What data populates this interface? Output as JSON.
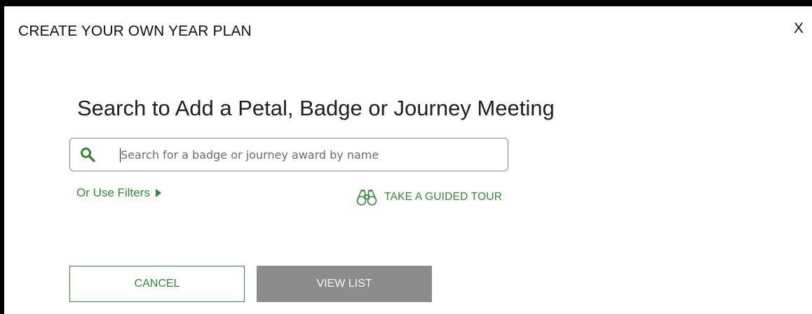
{
  "modal": {
    "title": "CREATE YOUR OWN YEAR PLAN",
    "close_label": "X"
  },
  "heading": "Search to Add a Petal, Badge or Journey Meeting",
  "search": {
    "placeholder": "Search for a badge or journey award by name",
    "value": "",
    "icon": "search-icon"
  },
  "links": {
    "filters_label": "Or Use Filters",
    "tour_label": "TAKE A GUIDED TOUR",
    "tour_icon": "binoculars-icon"
  },
  "buttons": {
    "cancel_label": "CANCEL",
    "view_list_label": "VIEW LIST"
  },
  "colors": {
    "accent": "#2e8b2e",
    "disabled": "#8c8c8c"
  }
}
